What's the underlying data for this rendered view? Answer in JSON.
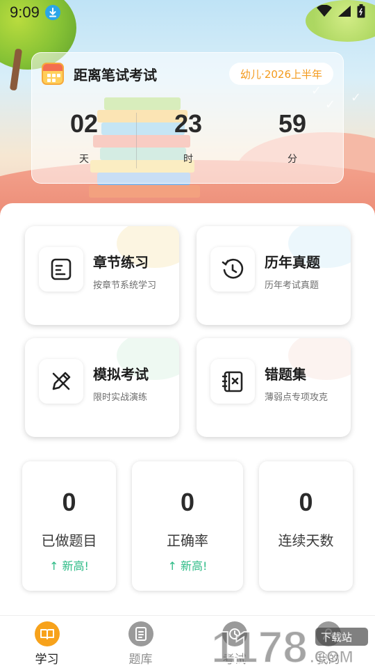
{
  "status_bar": {
    "time": "9:09",
    "icons": [
      "download-icon",
      "wifi-icon",
      "signal-icon",
      "battery-icon"
    ]
  },
  "countdown": {
    "title": "距离笔试考试",
    "tag": "幼儿·2026上半年",
    "days_value": "02",
    "days_unit": "天",
    "hours_value": "23",
    "hours_unit": "时",
    "minutes_value": "59",
    "minutes_unit": "分"
  },
  "features": [
    {
      "title": "章节练习",
      "subtitle": "按章节系统学习",
      "icon": "chapter-icon"
    },
    {
      "title": "历年真题",
      "subtitle": "历年考试真题",
      "icon": "history-icon"
    },
    {
      "title": "模拟考试",
      "subtitle": "限时实战演练",
      "icon": "mock-exam-icon"
    },
    {
      "title": "错题集",
      "subtitle": "薄弱点专项攻克",
      "icon": "wrong-questions-icon"
    }
  ],
  "stats": [
    {
      "value": "0",
      "label": "已做题目",
      "trend": "↑ 新高!"
    },
    {
      "value": "0",
      "label": "正确率",
      "trend": "↑ 新高!"
    },
    {
      "value": "0",
      "label": "连续天数",
      "trend": ""
    }
  ],
  "bottom_nav": [
    {
      "label": "学习",
      "icon": "book-icon",
      "active": true
    },
    {
      "label": "题库",
      "icon": "question-bank-icon",
      "active": false
    },
    {
      "label": "考试",
      "icon": "exam-icon",
      "active": false
    },
    {
      "label": "我的",
      "icon": "profile-icon",
      "active": false
    }
  ],
  "watermark": {
    "brand": "1178",
    "suffix": ".COM",
    "badge": "下载站"
  },
  "colors": {
    "accent_orange": "#f39a1c",
    "trend_green": "#2dbb86",
    "nav_active": "#f7a21b"
  }
}
